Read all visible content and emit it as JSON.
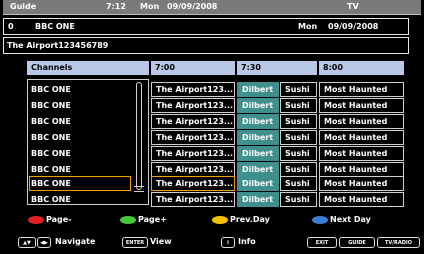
{
  "topbar": {
    "title": "Guide",
    "time": "7:12",
    "day": "Mon",
    "date": "09/09/2008",
    "mode": "TV"
  },
  "channel_info": {
    "number": "0",
    "name": "BBC ONE",
    "day": "Mon",
    "date": "09/09/2008"
  },
  "program_info": {
    "title": "The Airport123456789"
  },
  "grid": {
    "header": {
      "channels": "Channels",
      "t1": "7:00",
      "t2": "7:30",
      "t3": "8:00"
    },
    "rows": [
      {
        "channel": "BBC ONE",
        "p1": "The Airport123...",
        "p2": "Dilbert",
        "p3": "Sushi",
        "p4": "Most Haunted"
      },
      {
        "channel": "BBC ONE",
        "p1": "The Airport123...",
        "p2": "Dilbert",
        "p3": "Sushi",
        "p4": "Most Haunted"
      },
      {
        "channel": "BBC ONE",
        "p1": "The Airport123...",
        "p2": "Dilbert",
        "p3": "Sushi",
        "p4": "Most Haunted"
      },
      {
        "channel": "BBC ONE",
        "p1": "The Airport123...",
        "p2": "Dilbert",
        "p3": "Sushi",
        "p4": "Most Haunted"
      },
      {
        "channel": "BBC ONE",
        "p1": "The Airport123...",
        "p2": "Dilbert",
        "p3": "Sushi",
        "p4": "Most Haunted"
      },
      {
        "channel": "BBC ONE",
        "p1": "The Airport123...",
        "p2": "Dilbert",
        "p3": "Sushi",
        "p4": "Most Haunted"
      },
      {
        "channel": "BBC ONE",
        "p1": "The Airport123...",
        "p2": "Dilbert",
        "p3": "Sushi",
        "p4": "Most Haunted"
      },
      {
        "channel": "BBC ONE",
        "p1": "The Airport123...",
        "p2": "Dilbert",
        "p3": "Sushi",
        "p4": "Most Haunted"
      }
    ]
  },
  "legend": {
    "red": "Page-",
    "green": "Page+",
    "yellow": "Prev.Day",
    "blue": "Next Day"
  },
  "footer": {
    "navigate": "Navigate",
    "enter_key": "ENTER",
    "view": "View",
    "info_key": "i",
    "info": "Info",
    "exit_key": "EXIT",
    "guide_key": "GUIDE",
    "tvradio_key": "TV/RADIO"
  },
  "colors": {
    "red": "#e02020",
    "green": "#46c83a",
    "yellow": "#f2c100",
    "blue": "#3a7fd0",
    "header_bg": "#b8c8e6",
    "dilbert_bg": "#3f8f8c",
    "focus": "#f39c12"
  }
}
